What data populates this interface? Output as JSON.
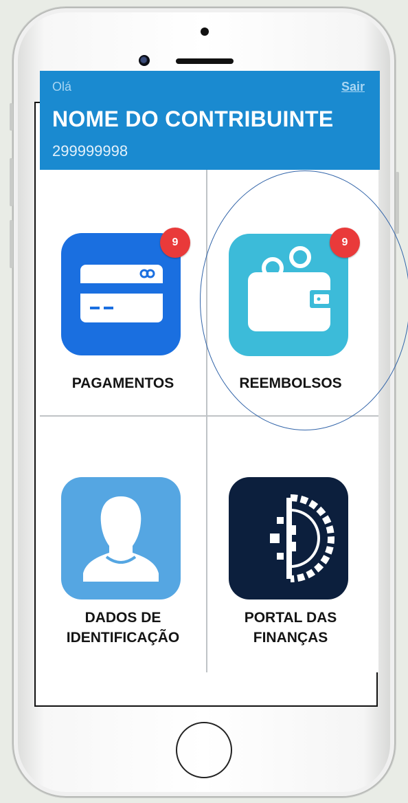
{
  "header": {
    "greeting": "Olá",
    "logout_label": "Sair",
    "taxpayer_name": "NOME DO CONTRIBUINTE",
    "taxpayer_nif": "299999998"
  },
  "tiles": [
    {
      "label": "PAGAMENTOS",
      "icon": "credit-card-icon",
      "badge": "9",
      "color": "#1a6fe0"
    },
    {
      "label": "REEMBOLSOS",
      "icon": "wallet-icon",
      "badge": "9",
      "color": "#3cbbd9"
    },
    {
      "label_line1": "DADOS DE",
      "label_line2": "IDENTIFICAÇÃO",
      "icon": "person-icon",
      "color": "#55a6e2"
    },
    {
      "label_line1": "PORTAL DAS",
      "label_line2": "FINANÇAS",
      "icon": "portugal-shield-icon",
      "color": "#0c1f3d"
    }
  ],
  "colors": {
    "header_bg": "#1a8ad0",
    "badge": "#e93a3a",
    "annotation": "#3063a8"
  }
}
